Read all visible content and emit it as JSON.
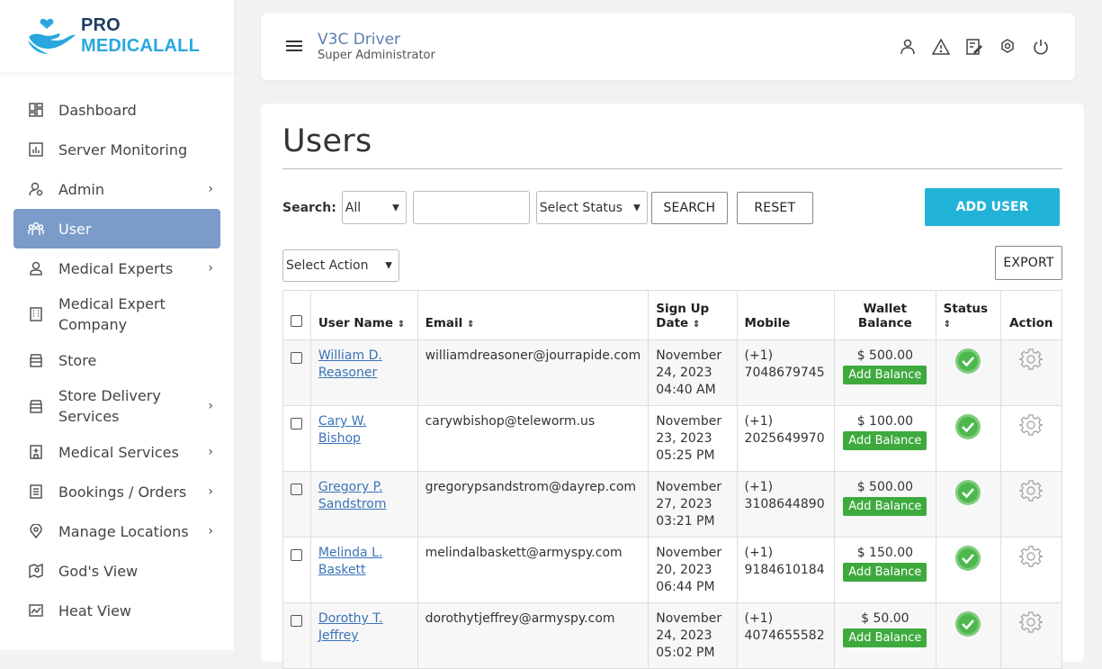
{
  "brand": {
    "pro": "PRO",
    "name": "MEDICALALL"
  },
  "sidebar": {
    "items": [
      {
        "label": "Dashboard",
        "icon": "dashboard-icon",
        "chevron": false
      },
      {
        "label": "Server Monitoring",
        "icon": "chart-icon",
        "chevron": false
      },
      {
        "label": "Admin",
        "icon": "admin-icon",
        "chevron": true
      },
      {
        "label": "User",
        "icon": "users-icon",
        "chevron": false,
        "active": true
      },
      {
        "label": "Medical Experts",
        "icon": "person-icon",
        "chevron": true
      },
      {
        "label": "Medical Expert Company",
        "icon": "building-icon",
        "chevron": false
      },
      {
        "label": "Store",
        "icon": "store-icon",
        "chevron": false
      },
      {
        "label": "Store Delivery Services",
        "icon": "store-icon",
        "chevron": true
      },
      {
        "label": "Medical Services",
        "icon": "hospital-icon",
        "chevron": true
      },
      {
        "label": "Bookings / Orders",
        "icon": "list-icon",
        "chevron": true
      },
      {
        "label": "Manage Locations",
        "icon": "location-icon",
        "chevron": true
      },
      {
        "label": "God's View",
        "icon": "map-icon",
        "chevron": false
      },
      {
        "label": "Heat View",
        "icon": "heatmap-icon",
        "chevron": false
      }
    ]
  },
  "header": {
    "title": "V3C Driver",
    "subtitle": "Super Administrator"
  },
  "page": {
    "title": "Users"
  },
  "search": {
    "label": "Search:",
    "field_select": "All",
    "query": "",
    "status_select": "Select Status",
    "search_button": "SEARCH",
    "reset_button": "RESET",
    "add_button": "ADD USER"
  },
  "actions": {
    "select_action": "Select Action",
    "export_button": "EXPORT"
  },
  "table": {
    "headers": {
      "name": "User Name",
      "email": "Email",
      "signup": "Sign Up Date",
      "mobile": "Mobile",
      "wallet": "Wallet Balance",
      "status": "Status",
      "action": "Action"
    },
    "add_balance_label": "Add Balance",
    "rows": [
      {
        "name": "William D. Reasoner",
        "email": "williamdreasoner@jourrapide.com",
        "signup": "November 24, 2023 04:40 AM",
        "mobile": "(+1) 7048679745",
        "wallet": "$ 500.00"
      },
      {
        "name": "Cary W. Bishop",
        "email": "carywbishop@teleworm.us",
        "signup": "November 23, 2023 05:25 PM",
        "mobile": "(+1) 2025649970",
        "wallet": "$ 100.00"
      },
      {
        "name": "Gregory P. Sandstrom",
        "email": "gregorypsandstrom@dayrep.com",
        "signup": "November 27, 2023 03:21 PM",
        "mobile": "(+1) 3108644890",
        "wallet": "$ 500.00"
      },
      {
        "name": "Melinda L. Baskett",
        "email": "melindalbaskett@armyspy.com",
        "signup": "November 20, 2023 06:44 PM",
        "mobile": "(+1) 9184610184",
        "wallet": "$ 150.00"
      },
      {
        "name": "Dorothy T. Jeffrey",
        "email": "dorothytjeffrey@armyspy.com",
        "signup": "November 24, 2023 05:02 PM",
        "mobile": "(+1) 4074655582",
        "wallet": "$ 50.00"
      }
    ]
  },
  "colors": {
    "accent": "#22b3d8",
    "active_nav": "#7b9bc9",
    "status_ok": "#3eaa3e",
    "link": "#3a73b8"
  }
}
